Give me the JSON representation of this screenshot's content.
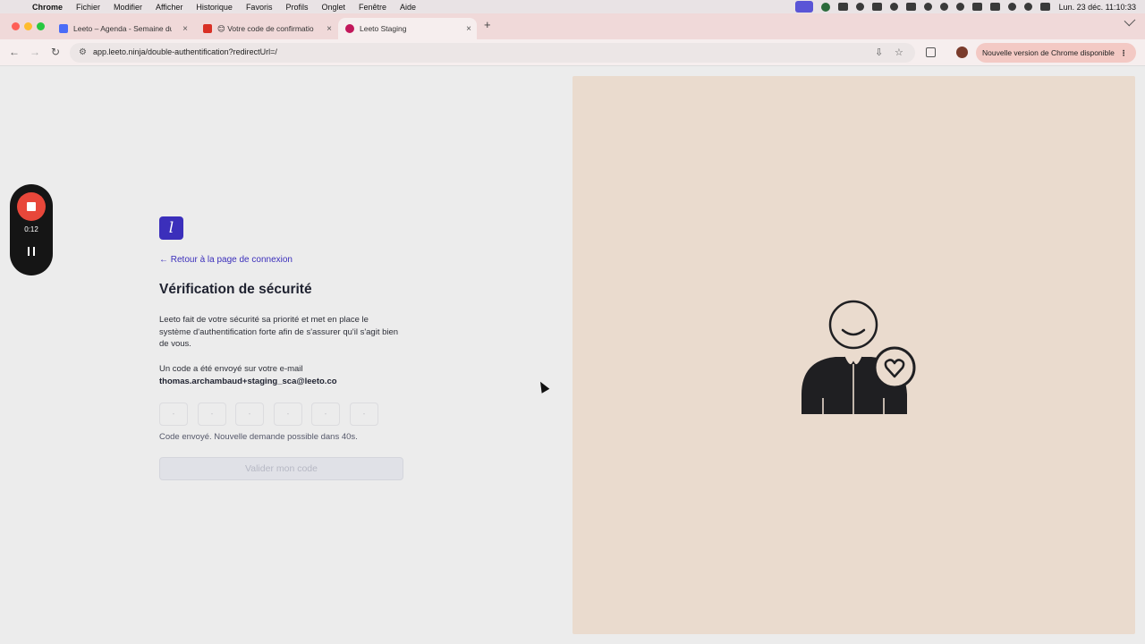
{
  "menubar": {
    "app": "Chrome",
    "items": [
      "Fichier",
      "Modifier",
      "Afficher",
      "Historique",
      "Favoris",
      "Profils",
      "Onglet",
      "Fenêtre",
      "Aide"
    ],
    "clock": "Lun. 23 déc. 11:10:33"
  },
  "tabs": [
    {
      "title": "Leeto – Agenda - Semaine du",
      "favicon": "calendar-icon",
      "color": "#4a6cf7"
    },
    {
      "title": "😊 Votre code de confirmatio",
      "favicon": "gmail-icon",
      "color": "#d93025"
    },
    {
      "title": "Leeto Staging",
      "favicon": "leeto-icon",
      "color": "#c2185b"
    }
  ],
  "toolbar": {
    "url": "app.leeto.ninja/double-authentification?redirectUrl=/",
    "update_label": "Nouvelle version de Chrome disponible"
  },
  "recorder": {
    "time": "0:12"
  },
  "auth": {
    "logo_letter": "l",
    "back_link": "← Retour à la page de connexion",
    "title": "Vérification de sécurité",
    "description": "Leeto fait de votre sécurité sa priorité et met en place le système d'authentification forte afin de s'assurer qu'il s'agit bien de vous.",
    "sent_label": "Un code a été envoyé sur votre e-mail",
    "email": "thomas.archambaud+staging_sca@leeto.co",
    "code_placeholders": [
      "-",
      "-",
      "-",
      "-",
      "-",
      "-"
    ],
    "status": "Code envoyé. Nouvelle demande possible dans 40s.",
    "submit_label": "Valider mon code"
  },
  "colors": {
    "brand": "#3b2fbb",
    "panel": "#eadbce",
    "recorder_stop": "#e8473a"
  }
}
